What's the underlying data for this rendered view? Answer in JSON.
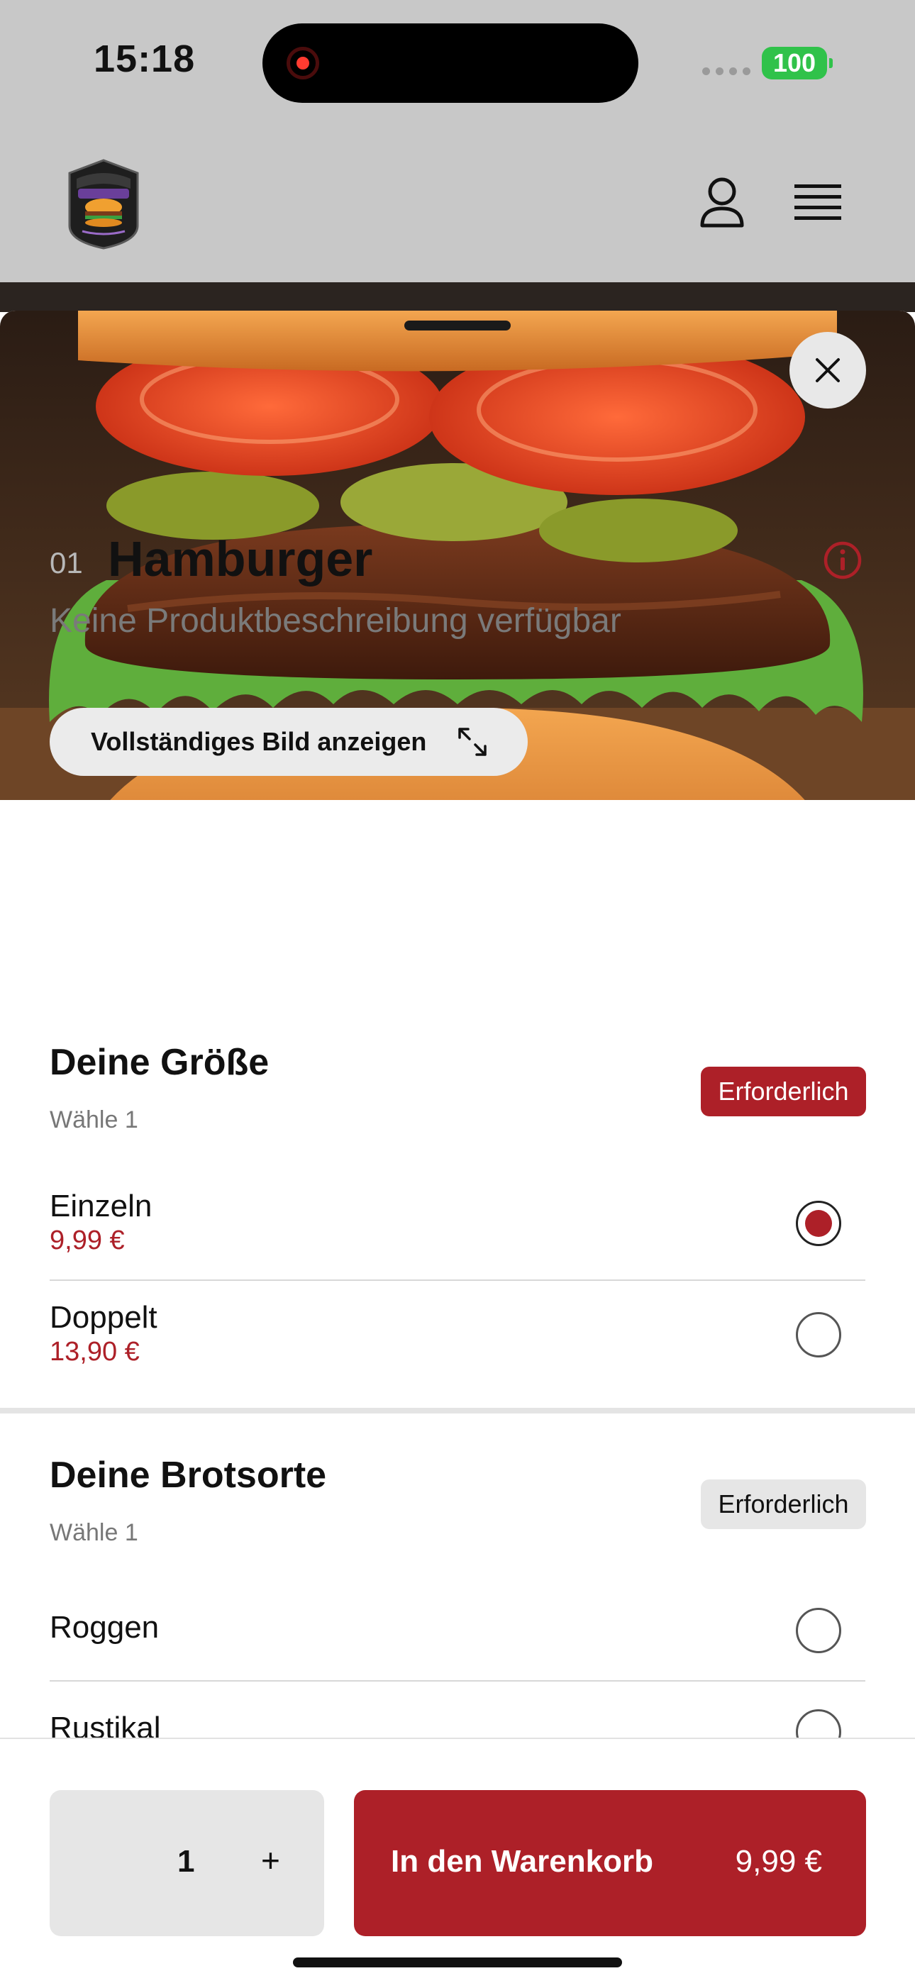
{
  "status_bar": {
    "time": "15:18",
    "battery": "100"
  },
  "header": {
    "logo_icon": "burger-shop-logo",
    "user_icon": "user-icon",
    "menu_icon": "menu-icon"
  },
  "hero": {
    "full_image_button": "Vollständiges Bild anzeigen",
    "close_icon": "close-icon",
    "expand_icon": "expand-icon"
  },
  "product": {
    "number": "01",
    "title": "Hamburger",
    "description": "Keine Produktbeschreibung verfügbar"
  },
  "groups": [
    {
      "title": "Deine Größe",
      "choose": "Wähle 1",
      "badge": "Erforderlich",
      "options": [
        {
          "name": "Einzeln",
          "price": "9,99 €",
          "selected": true
        },
        {
          "name": "Doppelt",
          "price": "13,90 €",
          "selected": false
        }
      ]
    },
    {
      "title": "Deine Brotsorte",
      "choose": "Wähle 1",
      "badge": "Erforderlich",
      "options": [
        {
          "name": "Roggen",
          "selected": false
        },
        {
          "name": "Rustikal",
          "selected": false
        }
      ]
    }
  ],
  "cart": {
    "quantity": "1",
    "plus": "+",
    "add_label": "In den Warenkorb",
    "add_price": "9,99 €"
  },
  "colors": {
    "accent": "#ad2028",
    "battery": "#30c24a"
  }
}
